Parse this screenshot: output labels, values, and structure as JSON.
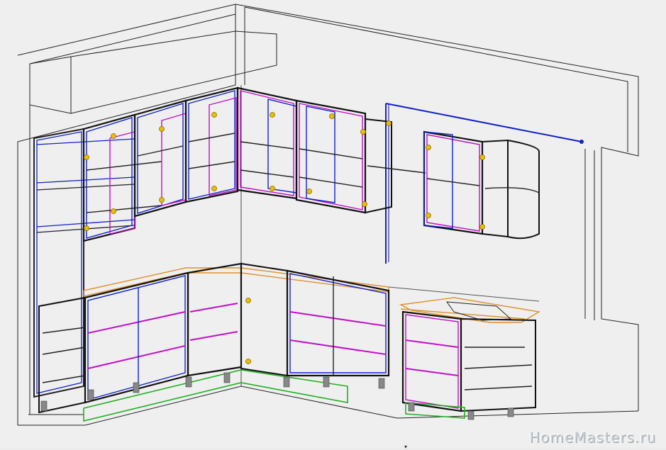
{
  "viewport": {
    "label": "3d-kitchen-wireframe-view",
    "colors": {
      "background": "#efefef",
      "wall_lines": "#222222",
      "cabinet_frame": "#1a1a1a",
      "cabinet_blue": "#1020c8",
      "cabinet_magenta": "#c010c8",
      "countertop": "#e0902a",
      "plinth": "#20b020",
      "hinge": "#e8c000",
      "leg": "#888888"
    },
    "icons": [
      "hinge-icon",
      "adjustable-leg-icon"
    ]
  },
  "watermark": {
    "text": "HomeMasters.ru"
  }
}
